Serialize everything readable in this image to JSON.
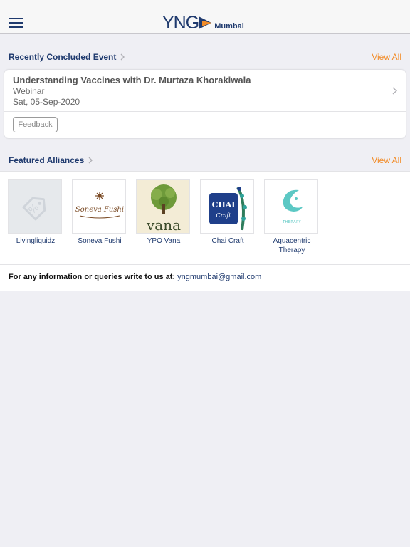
{
  "header": {
    "logo_text": "YNG",
    "city": "Mumbai"
  },
  "recent_event": {
    "section_title": "Recently Concluded Event",
    "view_all": "View All",
    "event": {
      "title": "Understanding Vaccines with Dr. Murtaza Khorakiwala",
      "type": "Webinar",
      "date": "Sat, 05-Sep-2020",
      "feedback_label": "Feedback"
    }
  },
  "alliances": {
    "section_title": "Featured Alliances",
    "view_all": "View All",
    "items": [
      {
        "name": "Livingliquidz",
        "logo_text": "%"
      },
      {
        "name": "Soneva Fushi",
        "logo_text": "Soneva Fushi"
      },
      {
        "name": "YPO Vana",
        "logo_text": "vana"
      },
      {
        "name": "Chai Craft",
        "logo_text": "CHAI Craft"
      },
      {
        "name": "Aquacentric Therapy",
        "logo_text": "THERAPY"
      }
    ]
  },
  "info": {
    "label": "For any information or queries write to us at:",
    "email": "yngmumbai@gmail.com"
  },
  "colors": {
    "brand_navy": "#1f3a6e",
    "accent_orange": "#f28c28",
    "background": "#efeff4"
  }
}
